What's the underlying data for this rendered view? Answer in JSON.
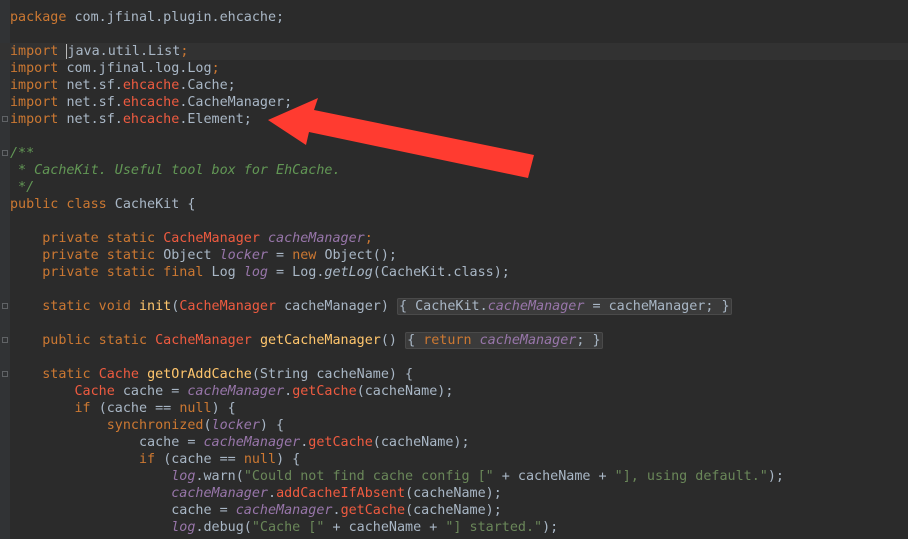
{
  "code": {
    "package_kw": "package",
    "package_name": " com.jfinal.plugin.ehcache;",
    "import_kw": "import",
    "imports": [
      {
        "pre": "java.util.List",
        "hl": "",
        "post": ";"
      },
      {
        "pre": "com.jfinal.log.Log",
        "hl": "",
        "post": ";"
      },
      {
        "pre": "net.sf.",
        "hl": "ehcache",
        "post": ".Cache;"
      },
      {
        "pre": "net.sf.",
        "hl": "ehcache",
        "post": ".CacheManager;"
      },
      {
        "pre": "net.sf.",
        "hl": "ehcache",
        "post": ".Element;"
      }
    ],
    "doc_open": "/**",
    "doc_body": " * CacheKit. Useful tool box for EhCache.",
    "doc_close": " */",
    "class_decl_kw": "public class",
    "class_name": " CacheKit {",
    "f1_kw": "    private static ",
    "f1_type": "CacheManager",
    "f1_name": "cacheManager",
    "f1_end": ";",
    "f2_kw": "    private static ",
    "f2_type": "Object ",
    "f2_name": "locker",
    "f2_mid": " = ",
    "f2_new": "new ",
    "f2_end": "Object();",
    "f3_kw": "    private static final ",
    "f3_type": "Log ",
    "f3_name": "log",
    "f3_mid": " = Log.",
    "f3_call": "getLog",
    "f3_end": "(CacheKit.class);",
    "m1_kw": "    static void ",
    "m1_name": "init",
    "m1_p1": "(",
    "m1_ptype": "CacheManager",
    "m1_p2": " cacheManager) ",
    "m1_body_a": "{ CacheKit.",
    "m1_field": "cacheManager",
    "m1_body_b": " = cacheManager; }",
    "m2_kw": "    public static ",
    "m2_type": "CacheManager ",
    "m2_name": "getCacheManager",
    "m2_p": "() ",
    "m2_body_a": "{ ",
    "m2_ret": "return ",
    "m2_field": "cacheManager",
    "m2_body_b": "; }",
    "m3_kw": "    static ",
    "m3_type": "Cache ",
    "m3_name": "getOrAddCache",
    "m3_p": "(String cacheName) {",
    "l1_type": "        Cache ",
    "l1_a": "cache = ",
    "l1_field": "cacheManager",
    "l1_b": ".",
    "l1_call": "getCache",
    "l1_c": "(cacheName);",
    "l2_kw": "        if ",
    "l2_a": "(cache == ",
    "l2_null": "null",
    "l2_b": ") {",
    "l3_kw": "            synchronized",
    "l3_a": "(",
    "l3_field": "locker",
    "l3_b": ") {",
    "l4_a": "                cache = ",
    "l4_field": "cacheManager",
    "l4_b": ".",
    "l4_call": "getCache",
    "l4_c": "(cacheName);",
    "l5_kw": "                if ",
    "l5_a": "(cache == ",
    "l5_null": "null",
    "l5_b": ") {",
    "l6_field": "log",
    "l6_a": ".warn(",
    "l6_s1": "\"Could not find cache config [\"",
    "l6_b": " + cacheName + ",
    "l6_s2": "\"], using default.\"",
    "l6_c": ");",
    "l7_field": "cacheManager",
    "l7_a": ".",
    "l7_call": "addCacheIfAbsent",
    "l7_b": "(cacheName);",
    "l8_a": "cache = ",
    "l8_field": "cacheManager",
    "l8_b": ".",
    "l8_call": "getCache",
    "l8_c": "(cacheName);",
    "l9_field": "log",
    "l9_a": ".debug(",
    "l9_s1": "\"Cache [\"",
    "l9_b": " + cacheName + ",
    "l9_s2": "\"] started.\"",
    "l9_c": ");"
  },
  "annotation": {
    "arrow_color": "#ff3b30"
  }
}
